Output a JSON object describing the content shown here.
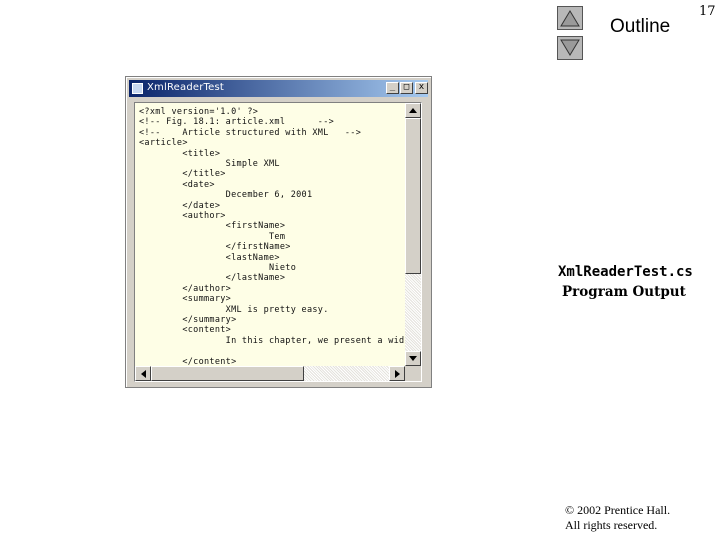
{
  "slide": {
    "page_number": "17",
    "outline_label": "Outline",
    "nav_up_icon": "triangle-up-icon",
    "nav_down_icon": "triangle-down-icon"
  },
  "window": {
    "title": "XmlReaderTest",
    "min_label": "_",
    "max_label": "□",
    "close_label": "x",
    "lines": [
      "<?xml version='1.0' ?>",
      "<!-- Fig. 18.1: article.xml      -->",
      "<!--    Article structured with XML   -->",
      "<article>",
      "        <title>",
      "                Simple XML",
      "        </title>",
      "        <date>",
      "                December 6, 2001",
      "        </date>",
      "        <author>",
      "                <firstName>",
      "                        Tem",
      "                </firstName>",
      "                <lastName>",
      "                        Nieto",
      "                </lastName>",
      "        </author>",
      "        <summary>",
      "                XML is pretty easy.",
      "        </summary>",
      "        <content>",
      "                In this chapter, we present a wide v",
      "",
      "        </content>"
    ]
  },
  "caption": {
    "filename": "XmlReaderTest.cs",
    "subtitle": "Program Output"
  },
  "footer": {
    "copyright": "© 2002 Prentice Hall.",
    "rights": "All rights reserved."
  }
}
